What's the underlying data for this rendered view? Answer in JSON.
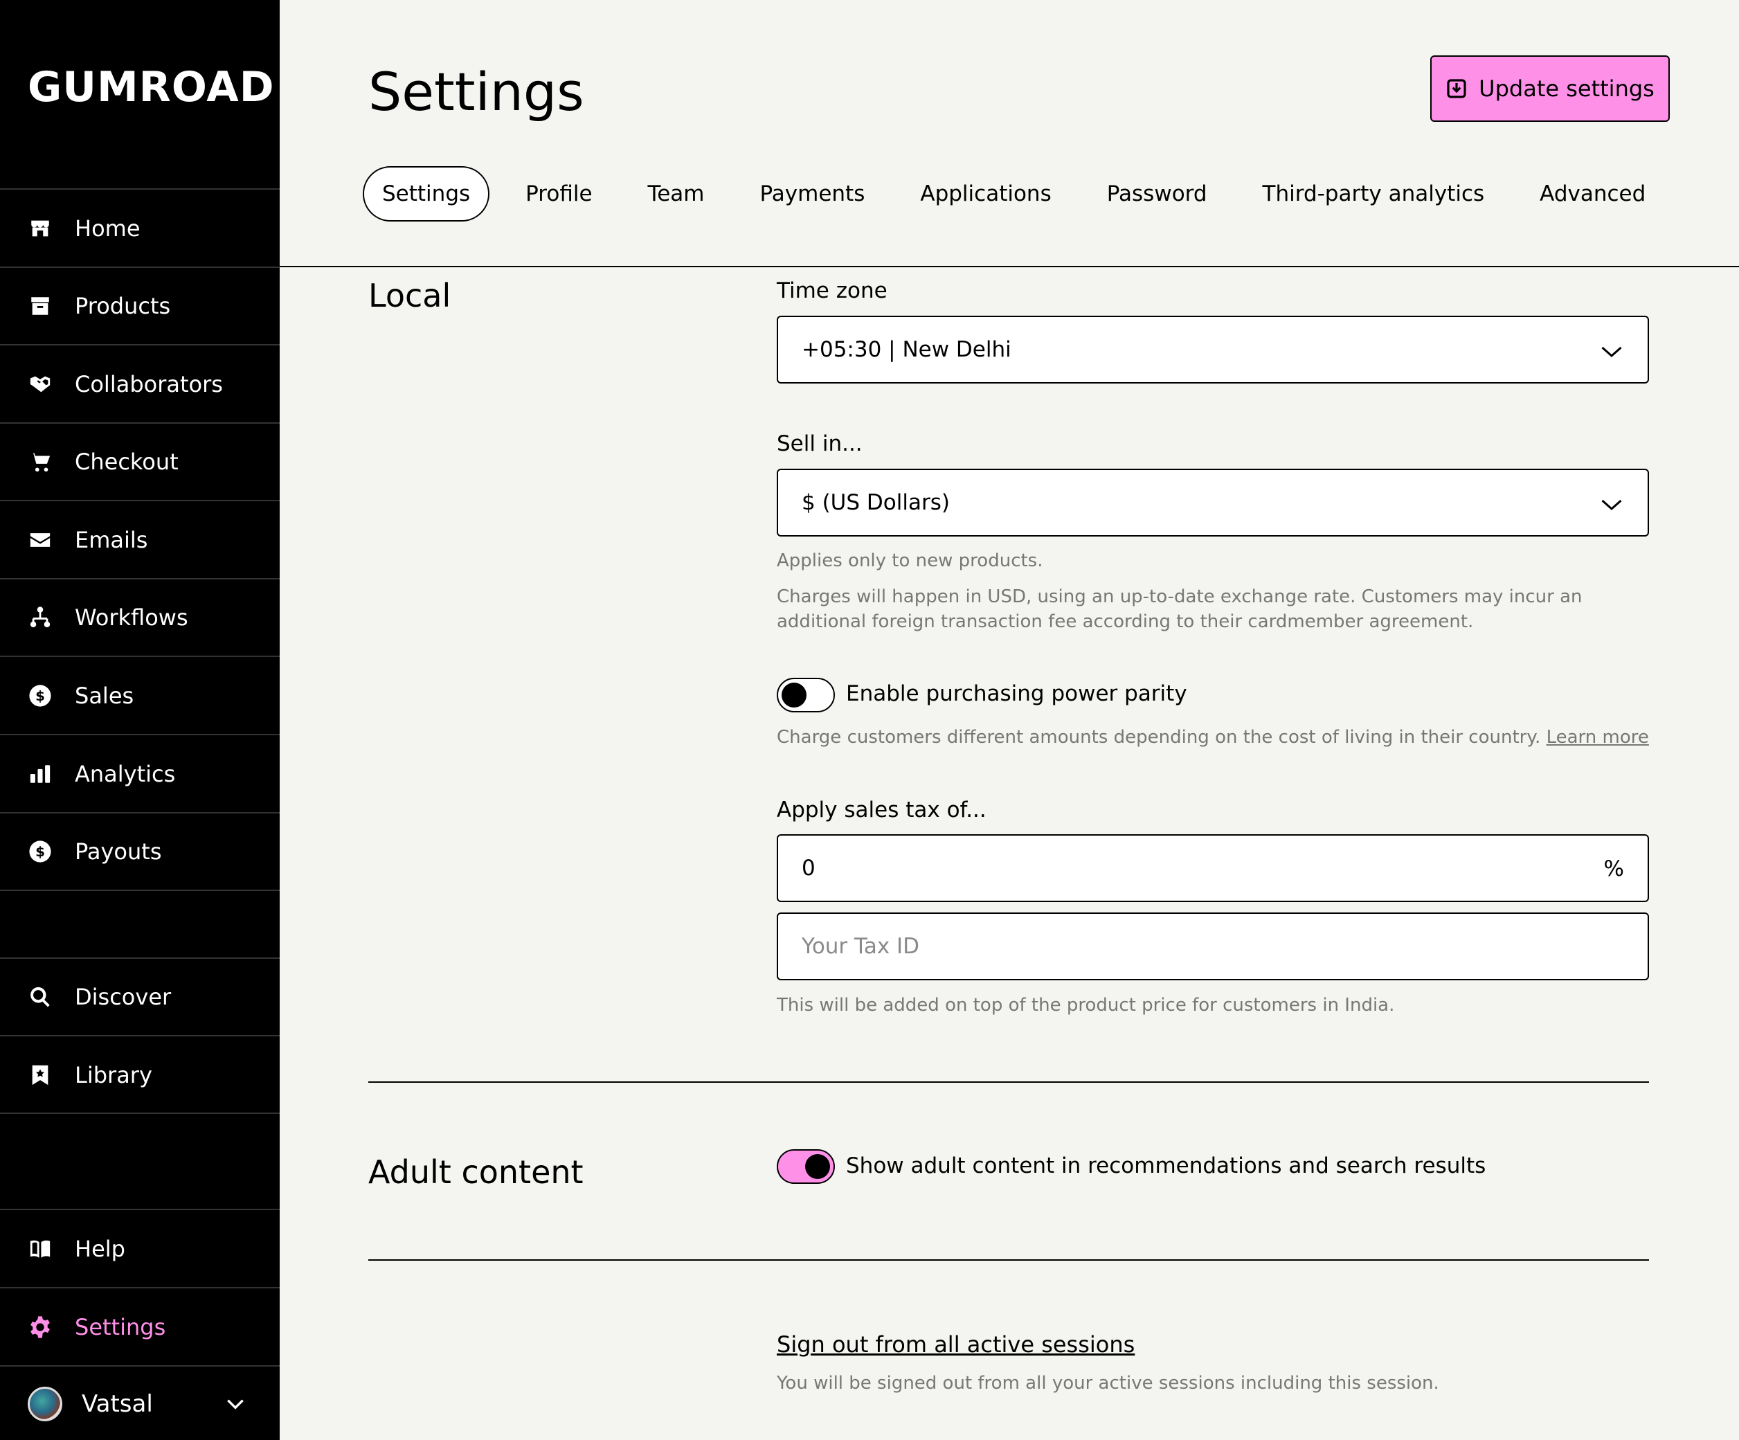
{
  "app": {
    "logo": "GUMROAD"
  },
  "sidebar": {
    "items": [
      {
        "label": "Home",
        "icon": "store-icon"
      },
      {
        "label": "Products",
        "icon": "archive-icon"
      },
      {
        "label": "Collaborators",
        "icon": "handshake-icon"
      },
      {
        "label": "Checkout",
        "icon": "cart-icon"
      },
      {
        "label": "Emails",
        "icon": "envelope-icon"
      },
      {
        "label": "Workflows",
        "icon": "workflow-icon"
      },
      {
        "label": "Sales",
        "icon": "dollar-circle-icon"
      },
      {
        "label": "Analytics",
        "icon": "bar-chart-icon"
      },
      {
        "label": "Payouts",
        "icon": "dollar-circle-icon"
      },
      {
        "label": "Discover",
        "icon": "search-icon"
      },
      {
        "label": "Library",
        "icon": "bookmark-icon"
      },
      {
        "label": "Help",
        "icon": "book-icon"
      },
      {
        "label": "Settings",
        "icon": "gear-icon",
        "active": true
      }
    ],
    "user": {
      "name": "Vatsal"
    }
  },
  "header": {
    "title": "Settings",
    "update_button": "Update settings",
    "tabs": [
      "Settings",
      "Profile",
      "Team",
      "Payments",
      "Applications",
      "Password",
      "Third-party analytics",
      "Advanced"
    ]
  },
  "local": {
    "title": "Local",
    "timezone_label": "Time zone",
    "timezone_value": "+05:30 | New Delhi",
    "currency_label": "Sell in...",
    "currency_value": "$ (US Dollars)",
    "currency_hint1": "Applies only to new products.",
    "currency_hint2": "Charges will happen in USD, using an up-to-date exchange rate. Customers may incur an additional foreign transaction fee according to their cardmember agreement.",
    "ppp_label": "Enable purchasing power parity",
    "ppp_hint": "Charge customers different amounts depending on the cost of living in their country.",
    "ppp_learn_more": "Learn more",
    "tax_label": "Apply sales tax of...",
    "tax_value": "0",
    "tax_suffix": "%",
    "tax_id_placeholder": "Your Tax ID",
    "tax_hint": "This will be added on top of the product price for customers in India."
  },
  "adult": {
    "title": "Adult content",
    "toggle_label": "Show adult content in recommendations and search results"
  },
  "sessions": {
    "link": "Sign out from all active sessions",
    "hint": "You will be signed out from all your active sessions including this session."
  },
  "colors": {
    "accent": "#ff90e8",
    "background": "#f4f4f0",
    "sidebar": "#000000"
  }
}
